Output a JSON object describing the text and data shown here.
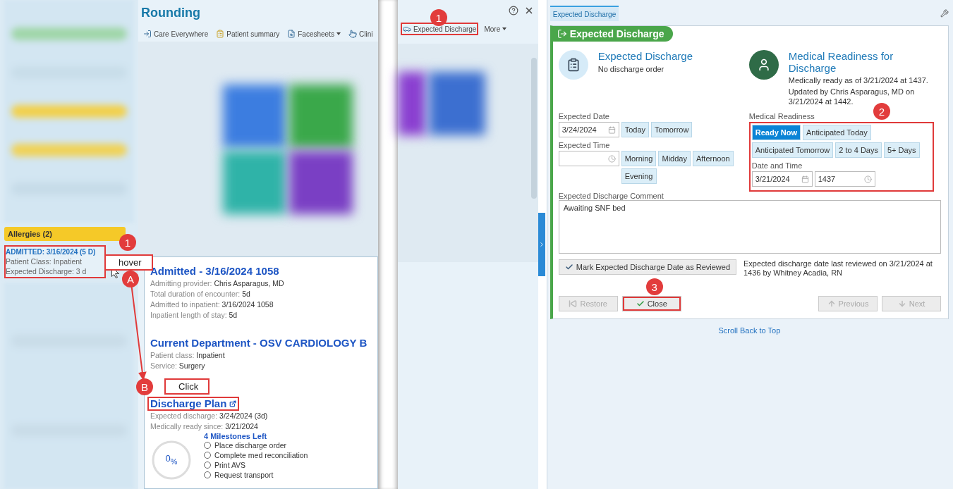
{
  "left_panel": {
    "allergies": "Allergies (2)",
    "admission_card": {
      "title": "ADMITTED: 3/16/2024 (5 D)",
      "lines": [
        "Patient Class: Inpatient",
        "Expected Discharge: 3 d"
      ],
      "highlighted": true
    }
  },
  "rounding": {
    "title": "Rounding",
    "toolbar": [
      {
        "label": "Care Everywhere",
        "dropdown": false,
        "highlighted": false
      },
      {
        "label": "Patient summary",
        "dropdown": false,
        "highlighted": false
      },
      {
        "label": "Facesheets",
        "dropdown": true,
        "highlighted": false
      },
      {
        "label": "Clini",
        "dropdown": false,
        "highlighted": false
      },
      {
        "label": "Expected Discharge",
        "dropdown": false,
        "highlighted": true
      },
      {
        "label": "More",
        "dropdown": true,
        "highlighted": false
      }
    ]
  },
  "popup": {
    "sections": [
      {
        "title": "Admitted - 3/16/2024 1058",
        "lines": [
          {
            "label": "Admitting provider:",
            "value": "Chris Asparagus, MD"
          },
          {
            "label": "Total duration of encounter:",
            "value": "5d"
          },
          {
            "label": "Admitted to inpatient:",
            "value": "3/16/2024 1058"
          },
          {
            "label": "Inpatient length of stay:",
            "value": "5d"
          }
        ]
      },
      {
        "title": "Current Department - OSV CARDIOLOGY B",
        "lines": [
          {
            "label": "Patient class:",
            "value": "Inpatient"
          },
          {
            "label": "Service:",
            "value": "Surgery"
          }
        ]
      }
    ],
    "discharge_plan": {
      "title": "Discharge Plan",
      "highlighted": true,
      "lines": [
        {
          "label": "Expected discharge:",
          "value": "3/24/2024 (3d)"
        },
        {
          "label": "Medically ready since:",
          "value": "3/21/2024"
        }
      ],
      "progress": {
        "text": "0$_{%}$",
        "level": 0
      },
      "milestones_title": "4 Milestones Left",
      "milestones": [
        {
          "label": "Place discharge order",
          "done": false
        },
        {
          "label": "Complete med reconciliation",
          "done": false
        },
        {
          "label": "Print AVS",
          "done": false
        },
        {
          "label": "Request transport",
          "done": false
        }
      ]
    }
  },
  "discharge_panel": {
    "tabs": [
      {
        "label": "Expected Discharge",
        "selected": true
      }
    ],
    "header": "Expected Discharge",
    "expected": {
      "title": "Expected Discharge",
      "subtitle": "No discharge order"
    },
    "readiness": {
      "title": "Medical Readiness for Discharge",
      "lines": [
        "Medically ready as of 3/21/2024 at 1437.",
        "Updated by Chris Asparagus, MD on 3/21/2024 at 1442."
      ]
    },
    "expected_date": {
      "label": "Expected Date",
      "value": "3/24/2024",
      "quick": [
        "Today",
        "Tomorrow"
      ]
    },
    "expected_time": {
      "label": "Expected Time",
      "quick": [
        "Morning",
        "Midday",
        "Afternoon",
        "Evening"
      ]
    },
    "medical_readiness": {
      "label": "Medical Readiness",
      "highlighted": true,
      "options": [
        {
          "label": "Ready Now",
          "selected": true
        },
        {
          "label": "Anticipated Today",
          "selected": false
        },
        {
          "label": "Anticipated Tomorrow",
          "selected": false
        },
        {
          "label": "2 to 4 Days",
          "selected": false
        },
        {
          "label": "5+ Days",
          "selected": false
        }
      ],
      "date_time_label": "Date and Time",
      "date": "3/21/2024",
      "time": "1437"
    },
    "comment": {
      "label": "Expected Discharge Comment",
      "value": "Awaiting SNF bed"
    },
    "review_button": "Mark Expected Discharge Date as Reviewed",
    "review_note": "Expected discharge date last reviewed on 3/21/2024 at 1436 by Whitney Acadia, RN",
    "footer": [
      {
        "kind": "restore",
        "label": "Restore",
        "disabled": true,
        "highlighted": false
      },
      {
        "kind": "close",
        "label": "Close",
        "disabled": false,
        "highlighted": true
      },
      {
        "kind": "previous",
        "label": "Previous",
        "disabled": true,
        "highlighted": false
      },
      {
        "kind": "next",
        "label": "Next",
        "disabled": true,
        "highlighted": false
      }
    ],
    "scroll_link": "Scroll Back to Top"
  },
  "callouts": [
    {
      "kind": "badge",
      "label": "1"
    },
    {
      "kind": "note",
      "label": "hover"
    },
    {
      "kind": "badge",
      "label": "A"
    },
    {
      "kind": "note",
      "label": "Click"
    },
    {
      "kind": "badge",
      "label": "B"
    },
    {
      "kind": "badge",
      "label": "1"
    },
    {
      "kind": "badge",
      "label": "2"
    },
    {
      "kind": "badge",
      "label": "3"
    }
  ]
}
